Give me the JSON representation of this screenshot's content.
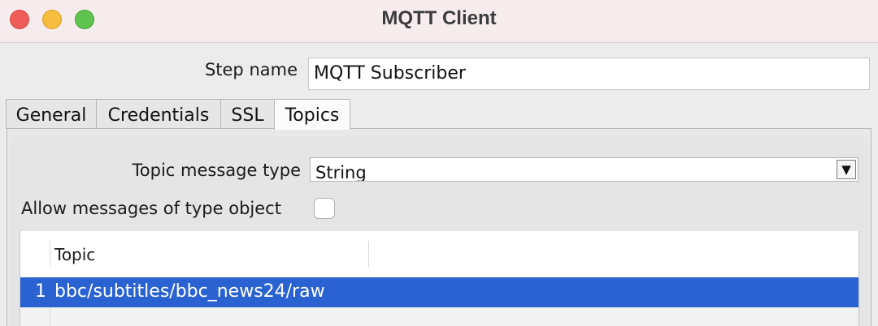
{
  "window": {
    "title": "MQTT Client"
  },
  "step": {
    "label": "Step name",
    "value": "MQTT Subscriber"
  },
  "tabs": [
    {
      "label": "General"
    },
    {
      "label": "Credentials"
    },
    {
      "label": "SSL"
    },
    {
      "label": "Topics",
      "active": true
    }
  ],
  "topics_tab": {
    "message_type_label": "Topic message type",
    "message_type_value": "String",
    "allow_object_label": "Allow messages of type object",
    "allow_object_checked": false,
    "table": {
      "columns": [
        "",
        "Topic"
      ],
      "rows": [
        {
          "num": "1",
          "topic": "bbc/subtitles/bbc_news24/raw",
          "selected": true
        }
      ]
    }
  },
  "colors": {
    "selection": "#2b62d1",
    "close": "#ee5d57",
    "minimize": "#f7bd3f",
    "maximize": "#5ec44e"
  }
}
